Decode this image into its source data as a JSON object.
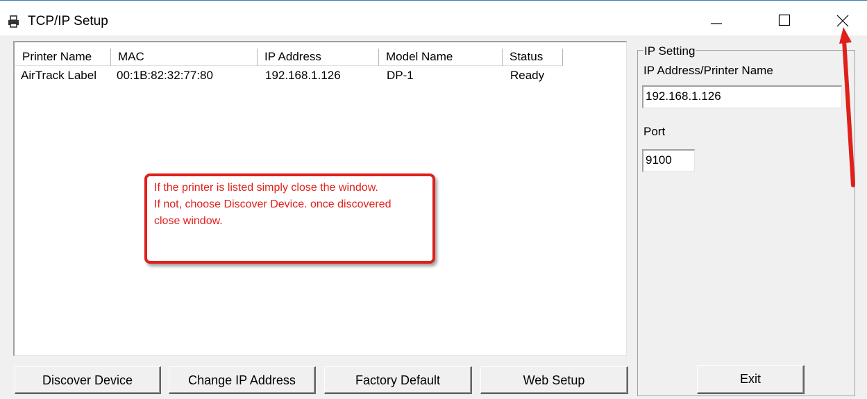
{
  "window": {
    "title": "TCP/IP Setup",
    "icon": "printer-icon",
    "controls": [
      "minimize-icon",
      "maximize-icon",
      "close-icon"
    ]
  },
  "printer_list": {
    "columns": [
      "Printer Name",
      "MAC",
      "IP Address",
      "Model Name",
      "Status"
    ],
    "rows": [
      [
        "AirTrack Label",
        "00:1B:82:32:77:80",
        "192.168.1.126",
        "DP-1",
        "Ready"
      ]
    ]
  },
  "callout": {
    "lines": [
      "If the printer is listed simply close the window.",
      "If not, choose Discover Device. once discovered",
      "close window."
    ],
    "color": "#e0201b"
  },
  "buttons": {
    "discover": "Discover Device",
    "change_ip": "Change IP Address",
    "factory_default": "Factory Default",
    "web_setup": "Web Setup",
    "exit": "Exit"
  },
  "ip_setting": {
    "group_title": "IP Setting",
    "address_label": "IP Address/Printer Name",
    "address_value": "192.168.1.126",
    "port_label": "Port",
    "port_value": "9100"
  },
  "annotation_arrow_color": "#e0201b"
}
